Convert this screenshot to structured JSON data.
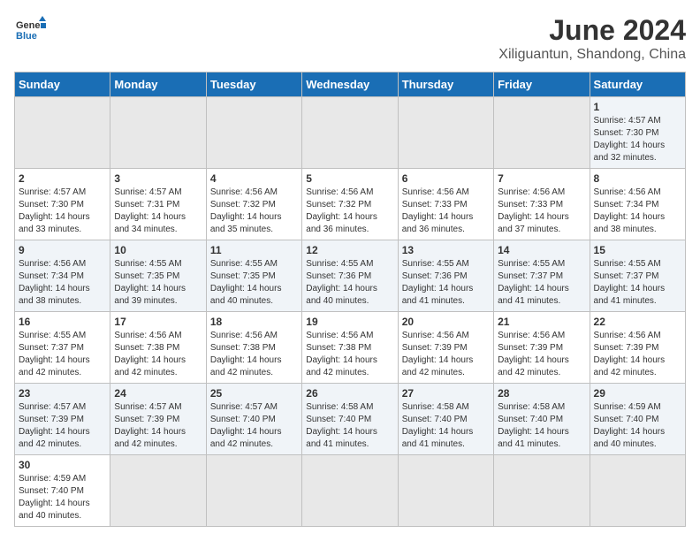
{
  "header": {
    "logo_general": "General",
    "logo_blue": "Blue",
    "title": "June 2024",
    "subtitle": "Xiliguantun, Shandong, China"
  },
  "weekdays": [
    "Sunday",
    "Monday",
    "Tuesday",
    "Wednesday",
    "Thursday",
    "Friday",
    "Saturday"
  ],
  "weeks": [
    [
      {
        "day": "",
        "sunrise": "",
        "sunset": "",
        "daylight": ""
      },
      {
        "day": "",
        "sunrise": "",
        "sunset": "",
        "daylight": ""
      },
      {
        "day": "",
        "sunrise": "",
        "sunset": "",
        "daylight": ""
      },
      {
        "day": "",
        "sunrise": "",
        "sunset": "",
        "daylight": ""
      },
      {
        "day": "",
        "sunrise": "",
        "sunset": "",
        "daylight": ""
      },
      {
        "day": "",
        "sunrise": "",
        "sunset": "",
        "daylight": ""
      },
      {
        "day": "1",
        "sunrise": "Sunrise: 4:57 AM",
        "sunset": "Sunset: 7:30 PM",
        "daylight": "Daylight: 14 hours and 32 minutes."
      }
    ],
    [
      {
        "day": "2",
        "sunrise": "Sunrise: 4:57 AM",
        "sunset": "Sunset: 7:30 PM",
        "daylight": "Daylight: 14 hours and 33 minutes."
      },
      {
        "day": "3",
        "sunrise": "Sunrise: 4:57 AM",
        "sunset": "Sunset: 7:31 PM",
        "daylight": "Daylight: 14 hours and 34 minutes."
      },
      {
        "day": "4",
        "sunrise": "Sunrise: 4:56 AM",
        "sunset": "Sunset: 7:32 PM",
        "daylight": "Daylight: 14 hours and 35 minutes."
      },
      {
        "day": "5",
        "sunrise": "Sunrise: 4:56 AM",
        "sunset": "Sunset: 7:32 PM",
        "daylight": "Daylight: 14 hours and 36 minutes."
      },
      {
        "day": "6",
        "sunrise": "Sunrise: 4:56 AM",
        "sunset": "Sunset: 7:33 PM",
        "daylight": "Daylight: 14 hours and 36 minutes."
      },
      {
        "day": "7",
        "sunrise": "Sunrise: 4:56 AM",
        "sunset": "Sunset: 7:33 PM",
        "daylight": "Daylight: 14 hours and 37 minutes."
      },
      {
        "day": "8",
        "sunrise": "Sunrise: 4:56 AM",
        "sunset": "Sunset: 7:34 PM",
        "daylight": "Daylight: 14 hours and 38 minutes."
      }
    ],
    [
      {
        "day": "9",
        "sunrise": "Sunrise: 4:56 AM",
        "sunset": "Sunset: 7:34 PM",
        "daylight": "Daylight: 14 hours and 38 minutes."
      },
      {
        "day": "10",
        "sunrise": "Sunrise: 4:55 AM",
        "sunset": "Sunset: 7:35 PM",
        "daylight": "Daylight: 14 hours and 39 minutes."
      },
      {
        "day": "11",
        "sunrise": "Sunrise: 4:55 AM",
        "sunset": "Sunset: 7:35 PM",
        "daylight": "Daylight: 14 hours and 40 minutes."
      },
      {
        "day": "12",
        "sunrise": "Sunrise: 4:55 AM",
        "sunset": "Sunset: 7:36 PM",
        "daylight": "Daylight: 14 hours and 40 minutes."
      },
      {
        "day": "13",
        "sunrise": "Sunrise: 4:55 AM",
        "sunset": "Sunset: 7:36 PM",
        "daylight": "Daylight: 14 hours and 41 minutes."
      },
      {
        "day": "14",
        "sunrise": "Sunrise: 4:55 AM",
        "sunset": "Sunset: 7:37 PM",
        "daylight": "Daylight: 14 hours and 41 minutes."
      },
      {
        "day": "15",
        "sunrise": "Sunrise: 4:55 AM",
        "sunset": "Sunset: 7:37 PM",
        "daylight": "Daylight: 14 hours and 41 minutes."
      }
    ],
    [
      {
        "day": "16",
        "sunrise": "Sunrise: 4:55 AM",
        "sunset": "Sunset: 7:37 PM",
        "daylight": "Daylight: 14 hours and 42 minutes."
      },
      {
        "day": "17",
        "sunrise": "Sunrise: 4:56 AM",
        "sunset": "Sunset: 7:38 PM",
        "daylight": "Daylight: 14 hours and 42 minutes."
      },
      {
        "day": "18",
        "sunrise": "Sunrise: 4:56 AM",
        "sunset": "Sunset: 7:38 PM",
        "daylight": "Daylight: 14 hours and 42 minutes."
      },
      {
        "day": "19",
        "sunrise": "Sunrise: 4:56 AM",
        "sunset": "Sunset: 7:38 PM",
        "daylight": "Daylight: 14 hours and 42 minutes."
      },
      {
        "day": "20",
        "sunrise": "Sunrise: 4:56 AM",
        "sunset": "Sunset: 7:39 PM",
        "daylight": "Daylight: 14 hours and 42 minutes."
      },
      {
        "day": "21",
        "sunrise": "Sunrise: 4:56 AM",
        "sunset": "Sunset: 7:39 PM",
        "daylight": "Daylight: 14 hours and 42 minutes."
      },
      {
        "day": "22",
        "sunrise": "Sunrise: 4:56 AM",
        "sunset": "Sunset: 7:39 PM",
        "daylight": "Daylight: 14 hours and 42 minutes."
      }
    ],
    [
      {
        "day": "23",
        "sunrise": "Sunrise: 4:57 AM",
        "sunset": "Sunset: 7:39 PM",
        "daylight": "Daylight: 14 hours and 42 minutes."
      },
      {
        "day": "24",
        "sunrise": "Sunrise: 4:57 AM",
        "sunset": "Sunset: 7:39 PM",
        "daylight": "Daylight: 14 hours and 42 minutes."
      },
      {
        "day": "25",
        "sunrise": "Sunrise: 4:57 AM",
        "sunset": "Sunset: 7:40 PM",
        "daylight": "Daylight: 14 hours and 42 minutes."
      },
      {
        "day": "26",
        "sunrise": "Sunrise: 4:58 AM",
        "sunset": "Sunset: 7:40 PM",
        "daylight": "Daylight: 14 hours and 41 minutes."
      },
      {
        "day": "27",
        "sunrise": "Sunrise: 4:58 AM",
        "sunset": "Sunset: 7:40 PM",
        "daylight": "Daylight: 14 hours and 41 minutes."
      },
      {
        "day": "28",
        "sunrise": "Sunrise: 4:58 AM",
        "sunset": "Sunset: 7:40 PM",
        "daylight": "Daylight: 14 hours and 41 minutes."
      },
      {
        "day": "29",
        "sunrise": "Sunrise: 4:59 AM",
        "sunset": "Sunset: 7:40 PM",
        "daylight": "Daylight: 14 hours and 40 minutes."
      }
    ],
    [
      {
        "day": "30",
        "sunrise": "Sunrise: 4:59 AM",
        "sunset": "Sunset: 7:40 PM",
        "daylight": "Daylight: 14 hours and 40 minutes."
      },
      {
        "day": "",
        "sunrise": "",
        "sunset": "",
        "daylight": ""
      },
      {
        "day": "",
        "sunrise": "",
        "sunset": "",
        "daylight": ""
      },
      {
        "day": "",
        "sunrise": "",
        "sunset": "",
        "daylight": ""
      },
      {
        "day": "",
        "sunrise": "",
        "sunset": "",
        "daylight": ""
      },
      {
        "day": "",
        "sunrise": "",
        "sunset": "",
        "daylight": ""
      },
      {
        "day": "",
        "sunrise": "",
        "sunset": "",
        "daylight": ""
      }
    ]
  ]
}
